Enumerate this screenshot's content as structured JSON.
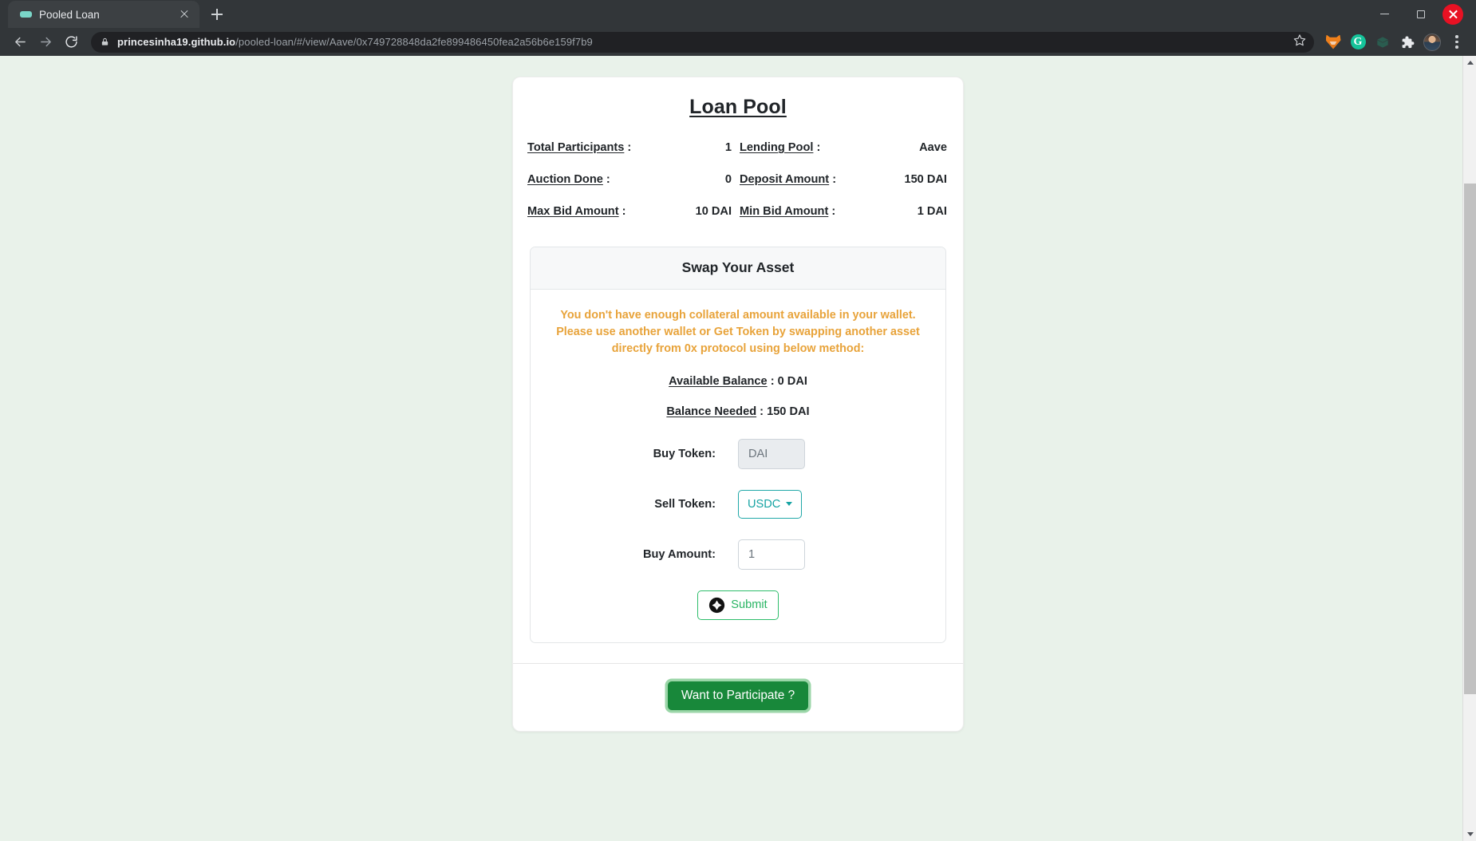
{
  "browser": {
    "tab": {
      "title": "Pooled Loan",
      "favicon_icon": "pill-favicon",
      "close_icon": "close-icon"
    },
    "new_tab_icon": "plus-icon",
    "window": {
      "minimize_icon": "minimize-icon",
      "maximize_icon": "maximize-icon",
      "close_icon": "window-close-icon"
    },
    "nav": {
      "back_icon": "back-arrow-icon",
      "forward_icon": "forward-arrow-icon",
      "reload_icon": "reload-icon"
    },
    "omnibox": {
      "lock_icon": "lock-icon",
      "url_host": "princesinha19.github.io",
      "url_path": "/pooled-loan/#/view/Aave/0x749728848da2fe899486450fea2a56b6e159f7b9",
      "star_icon": "star-icon"
    },
    "toolbar_icons": [
      "metamask-fox-icon",
      "grammarly-icon",
      "faded-extension-icon",
      "extensions-puzzle-icon",
      "profile-avatar",
      "chrome-menu-icon"
    ],
    "grammarly_letter": "G"
  },
  "page": {
    "title": "Loan Pool",
    "stats": [
      [
        {
          "label": "Total Participants",
          "separator": " :",
          "value": "1"
        },
        {
          "label": "Lending Pool",
          "separator": " :",
          "value": "Aave"
        }
      ],
      [
        {
          "label": "Auction Done",
          "separator": " :",
          "value": "0"
        },
        {
          "label": "Deposit Amount",
          "separator": " :",
          "value": "150 DAI"
        }
      ],
      [
        {
          "label": "Max Bid Amount",
          "separator": " :",
          "value": "10 DAI"
        },
        {
          "label": "Min Bid Amount",
          "separator": " :",
          "value": "1 DAI"
        }
      ]
    ],
    "swap": {
      "header": "Swap Your Asset",
      "warning": "You don't have enough collateral amount available in your wallet. Please use another wallet or Get Token by swapping another asset directly from 0x protocol using below method:",
      "warning_color": "#e8a33a",
      "available_balance_label": "Available Balance",
      "available_balance_value": " : 0 DAI",
      "balance_needed_label": "Balance Needed",
      "balance_needed_value": " : 150 DAI",
      "fields": {
        "buy_token_label": "Buy Token:",
        "buy_token_value": "DAI",
        "sell_token_label": "Sell Token:",
        "sell_token_value": "USDC",
        "buy_amount_label": "Buy Amount:",
        "buy_amount_value": "1"
      },
      "submit_label": "Submit",
      "submit_icon": "zrx-protocol-icon"
    },
    "participate_label": "Want to Participate ?",
    "colors": {
      "background": "#e9f2ea",
      "card": "#ffffff",
      "accent_teal": "#16a3a3",
      "accent_green": "#28b463",
      "participate_green": "#18883a",
      "warning_orange": "#e8a33a"
    }
  }
}
